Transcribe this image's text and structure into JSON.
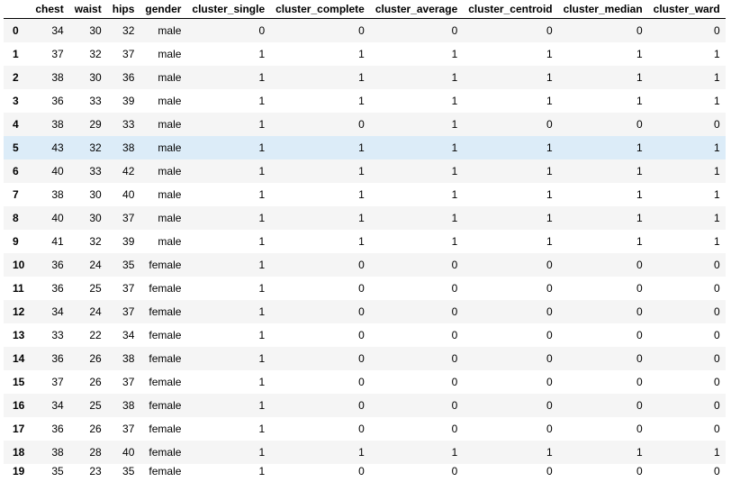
{
  "table": {
    "columns": [
      "",
      "chest",
      "waist",
      "hips",
      "gender",
      "cluster_single",
      "cluster_complete",
      "cluster_average",
      "cluster_centroid",
      "cluster_median",
      "cluster_ward"
    ],
    "highlighted_row": 5,
    "rows": [
      [
        "0",
        "34",
        "30",
        "32",
        "male",
        "0",
        "0",
        "0",
        "0",
        "0",
        "0"
      ],
      [
        "1",
        "37",
        "32",
        "37",
        "male",
        "1",
        "1",
        "1",
        "1",
        "1",
        "1"
      ],
      [
        "2",
        "38",
        "30",
        "36",
        "male",
        "1",
        "1",
        "1",
        "1",
        "1",
        "1"
      ],
      [
        "3",
        "36",
        "33",
        "39",
        "male",
        "1",
        "1",
        "1",
        "1",
        "1",
        "1"
      ],
      [
        "4",
        "38",
        "29",
        "33",
        "male",
        "1",
        "0",
        "1",
        "0",
        "0",
        "0"
      ],
      [
        "5",
        "43",
        "32",
        "38",
        "male",
        "1",
        "1",
        "1",
        "1",
        "1",
        "1"
      ],
      [
        "6",
        "40",
        "33",
        "42",
        "male",
        "1",
        "1",
        "1",
        "1",
        "1",
        "1"
      ],
      [
        "7",
        "38",
        "30",
        "40",
        "male",
        "1",
        "1",
        "1",
        "1",
        "1",
        "1"
      ],
      [
        "8",
        "40",
        "30",
        "37",
        "male",
        "1",
        "1",
        "1",
        "1",
        "1",
        "1"
      ],
      [
        "9",
        "41",
        "32",
        "39",
        "male",
        "1",
        "1",
        "1",
        "1",
        "1",
        "1"
      ],
      [
        "10",
        "36",
        "24",
        "35",
        "female",
        "1",
        "0",
        "0",
        "0",
        "0",
        "0"
      ],
      [
        "11",
        "36",
        "25",
        "37",
        "female",
        "1",
        "0",
        "0",
        "0",
        "0",
        "0"
      ],
      [
        "12",
        "34",
        "24",
        "37",
        "female",
        "1",
        "0",
        "0",
        "0",
        "0",
        "0"
      ],
      [
        "13",
        "33",
        "22",
        "34",
        "female",
        "1",
        "0",
        "0",
        "0",
        "0",
        "0"
      ],
      [
        "14",
        "36",
        "26",
        "38",
        "female",
        "1",
        "0",
        "0",
        "0",
        "0",
        "0"
      ],
      [
        "15",
        "37",
        "26",
        "37",
        "female",
        "1",
        "0",
        "0",
        "0",
        "0",
        "0"
      ],
      [
        "16",
        "34",
        "25",
        "38",
        "female",
        "1",
        "0",
        "0",
        "0",
        "0",
        "0"
      ],
      [
        "17",
        "36",
        "26",
        "37",
        "female",
        "1",
        "0",
        "0",
        "0",
        "0",
        "0"
      ],
      [
        "18",
        "38",
        "28",
        "40",
        "female",
        "1",
        "1",
        "1",
        "1",
        "1",
        "1"
      ],
      [
        "19",
        "35",
        "23",
        "35",
        "female",
        "1",
        "0",
        "0",
        "0",
        "0",
        "0"
      ]
    ]
  }
}
